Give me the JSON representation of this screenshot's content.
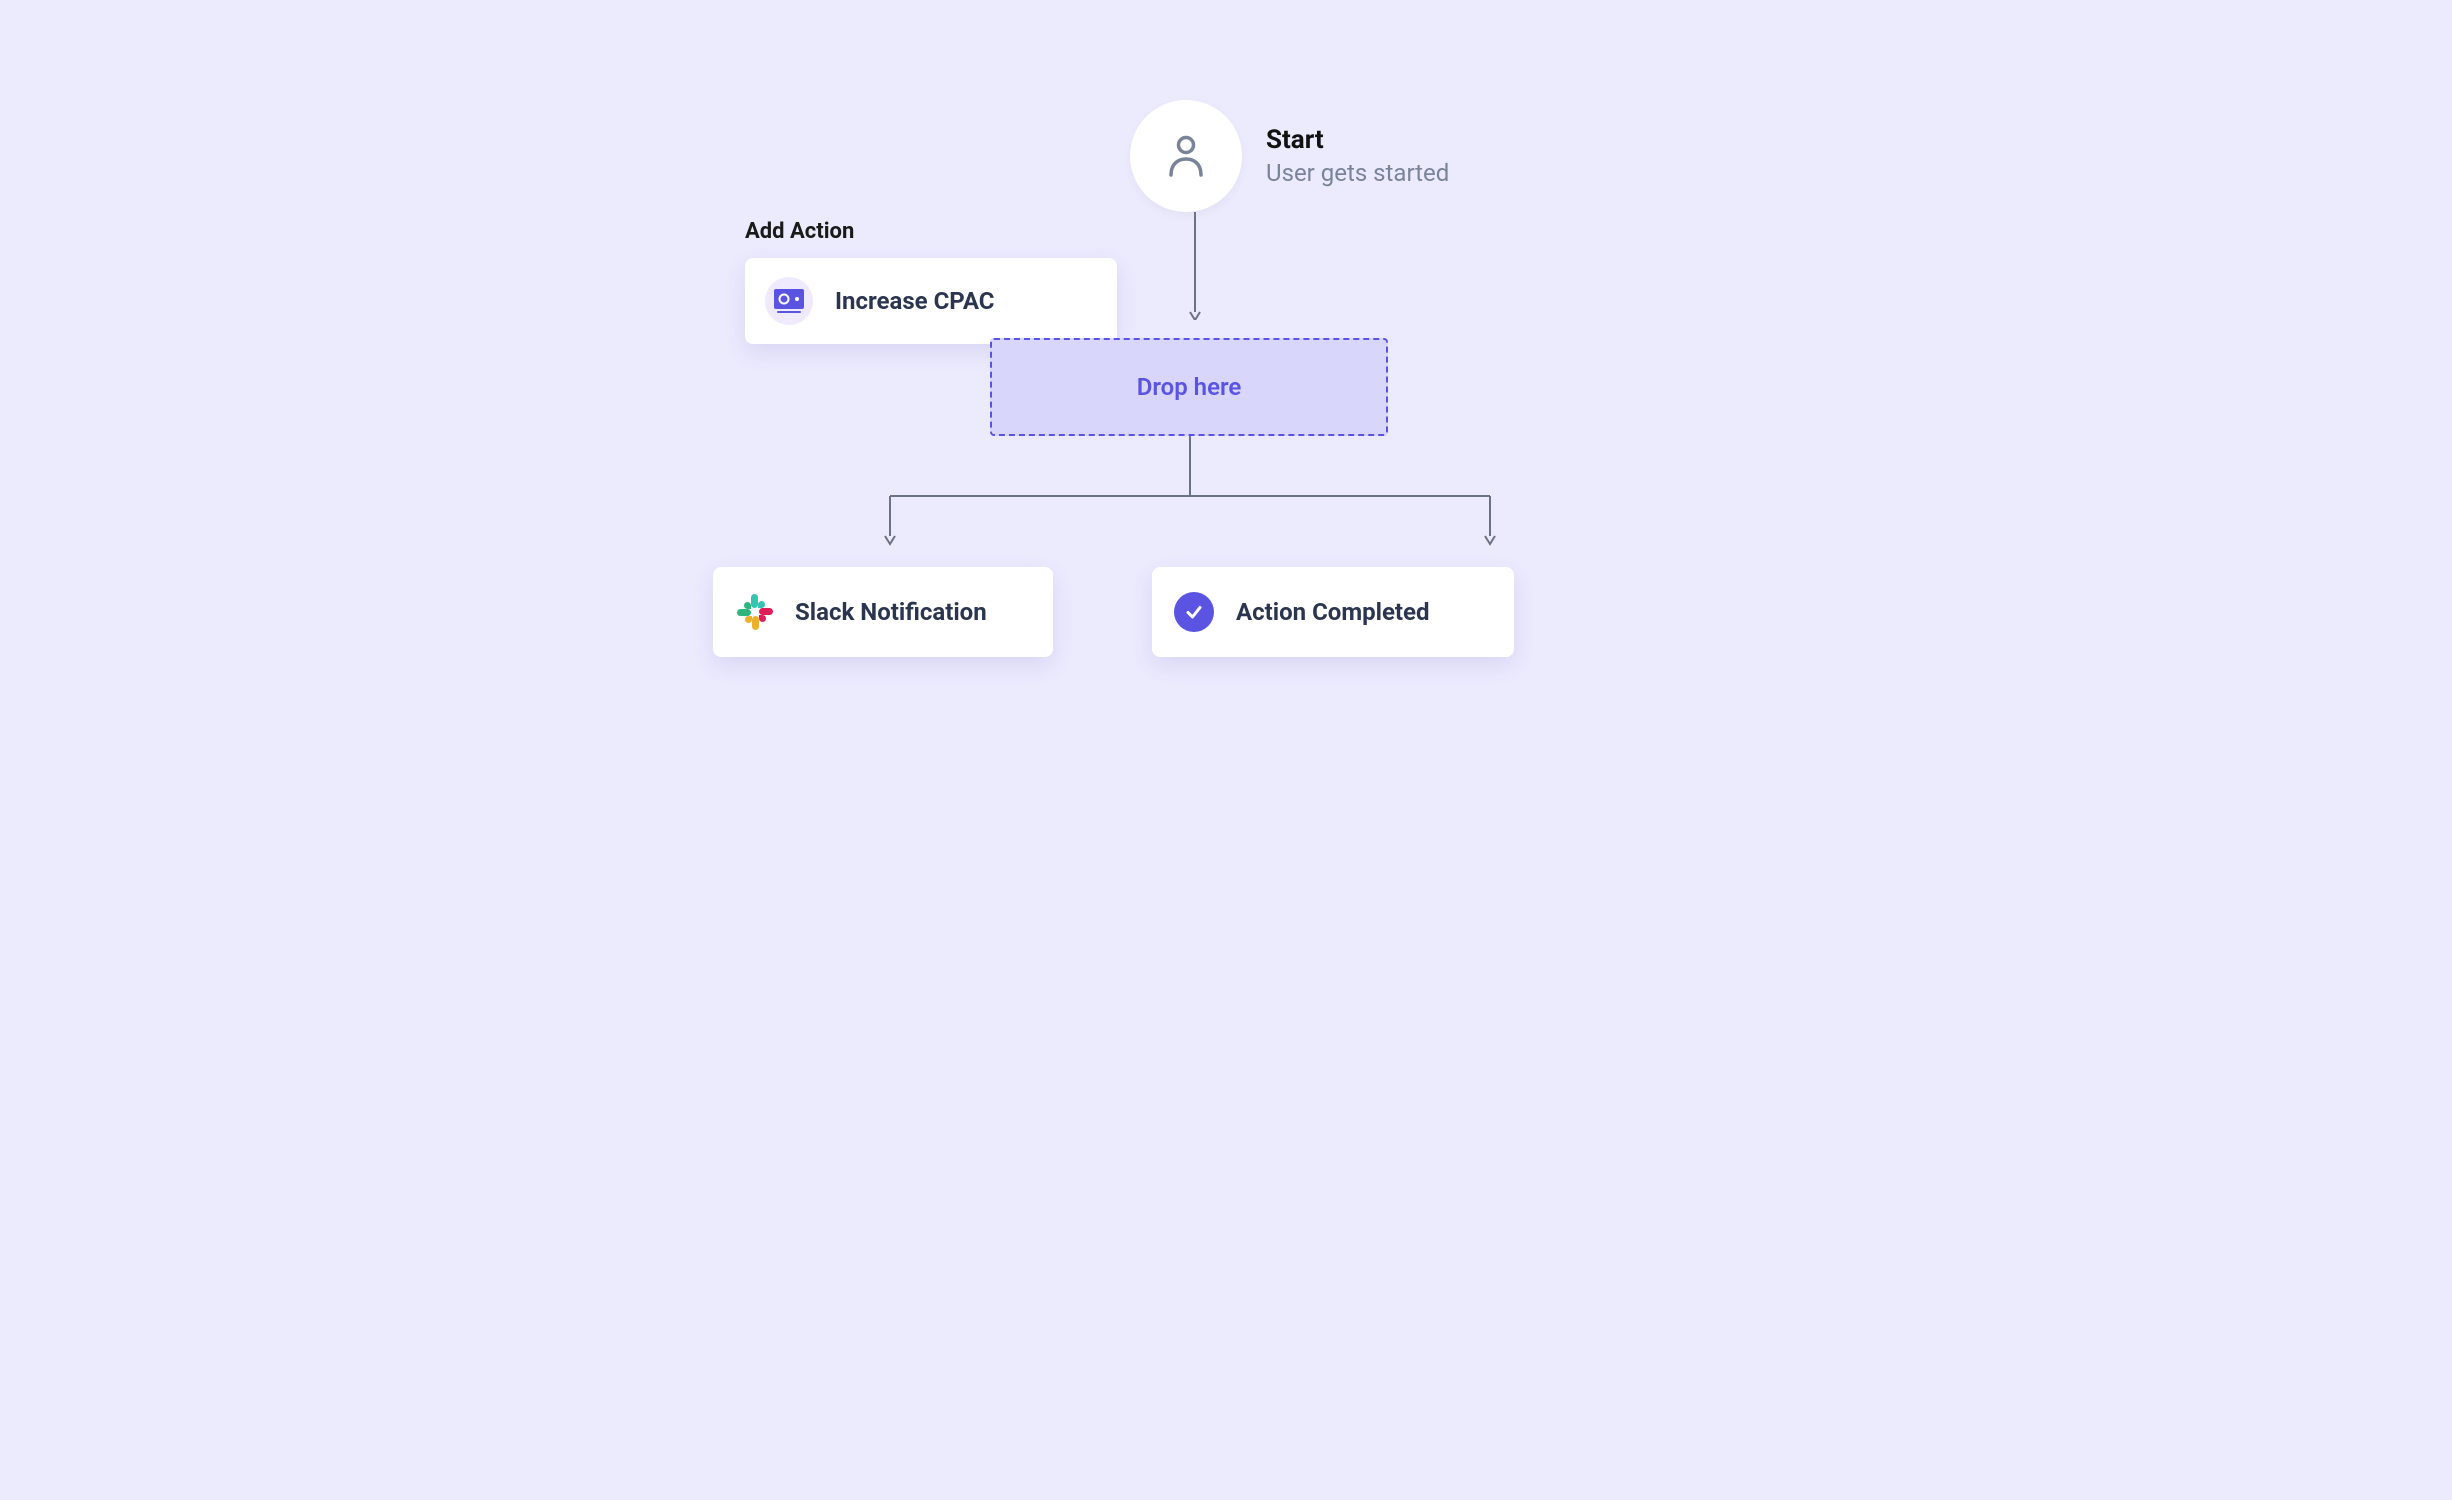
{
  "start": {
    "title": "Start",
    "subtitle": "User gets started"
  },
  "add_action": {
    "title": "Add Action",
    "card_label": "Increase CPAC"
  },
  "drop": {
    "label": "Drop here"
  },
  "bottom": {
    "slack_label": "Slack Notification",
    "done_label": "Action Completed"
  }
}
